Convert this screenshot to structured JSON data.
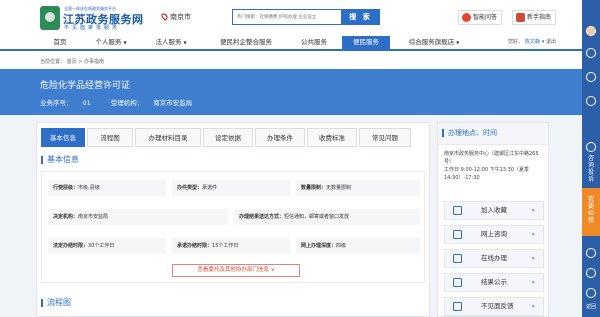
{
  "header": {
    "logo_small": "全国一体化在线政务服务平台",
    "logo_title": "江苏政务服务网",
    "logo_sub": "不见面审批服务",
    "city": "南京市",
    "search_placeholder": "热门搜索：社保缴费 护照办理 企业设立",
    "search_button": "搜 索",
    "ask_button": "智能问答",
    "guide_button": "新手指南"
  },
  "nav": {
    "items": [
      {
        "label": "首页",
        "caret": ""
      },
      {
        "label": "个人服务",
        "caret": "▼"
      },
      {
        "label": "法人服务",
        "caret": "▼"
      },
      {
        "label": "便民利企整合服务",
        "caret": ""
      },
      {
        "label": "公共服务",
        "caret": ""
      },
      {
        "label": "便民服务",
        "caret": ""
      },
      {
        "label": "综合服务旗舰店",
        "caret": "▼"
      }
    ],
    "greeting": "您好，",
    "user": "陈文静",
    "logout": "退出"
  },
  "breadcrumb": {
    "prefix": "当前位置：",
    "home": "首页",
    "sep": ">",
    "current": "办事指南"
  },
  "banner": {
    "title": "危险化学品经营许可证",
    "seq_label": "业务序号：",
    "seq_value": "01",
    "org_label": "受理机构：",
    "org_value": "南京市安监局"
  },
  "tabs": [
    "基本信息",
    "流程图",
    "办理材料目录",
    "设定依据",
    "办理条件",
    "收费标准",
    "常见问题"
  ],
  "sections": {
    "basic_info": "基本信息",
    "flow": "流程图"
  },
  "info": {
    "row1": [
      {
        "label": "行使层级：",
        "value": "市级,县级"
      },
      {
        "label": "办件类型：",
        "value": "承诺件"
      },
      {
        "label": "数量限制：",
        "value": "无数量限制"
      }
    ],
    "row2": [
      {
        "label": "决定机构：",
        "value": "南京市安监局"
      },
      {
        "label": "办理结果送达方式：",
        "value": "短信通知，邮寄或者窗口发放"
      }
    ],
    "row3": [
      {
        "label": "法定办结时限：",
        "value": "30个工作日"
      },
      {
        "label": "承诺办结时限：",
        "value": "15个工作日"
      },
      {
        "label": "网上办理深度：",
        "value": "四级"
      }
    ],
    "more_button": "查看委托及其他协办部门信息 ∨"
  },
  "side": {
    "title": "办理地点、时间",
    "address": "南京市政务服务中心（建邺区江东中路265号）",
    "hours": "工作日 9:00-12:00 下午13:30（夏季14:30）-17:30",
    "buttons": [
      "加入收藏",
      "网上咨询",
      "在线办理",
      "结果公示",
      "不见面反馈"
    ],
    "chevron": "»"
  },
  "rbar": {
    "consult": "咨询投诉",
    "correct": "我要纠错",
    "top": "返回"
  },
  "colors": {
    "primary": "#2d6ec7",
    "banner": "#3f7dcf",
    "more_btn": "#d9473a"
  }
}
